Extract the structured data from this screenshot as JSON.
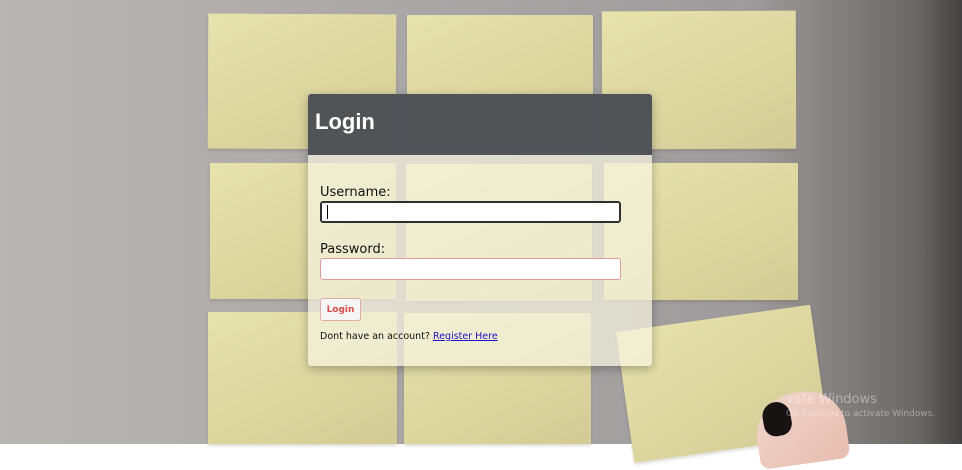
{
  "login_form": {
    "title": "Login",
    "username_label": "Username:",
    "username_value": "",
    "password_label": "Password:",
    "password_value": "",
    "submit_label": "Login",
    "account_prompt": "Dont have an account?",
    "register_link": "Register Here"
  },
  "system_watermark": {
    "line1": "vate Windows",
    "line2": "Go Settings to activate Windows."
  },
  "colors": {
    "header_background": "#4a4d52",
    "error_border": "#df9b9b",
    "login_text": "#d84b48",
    "link": "#1d11c9"
  }
}
